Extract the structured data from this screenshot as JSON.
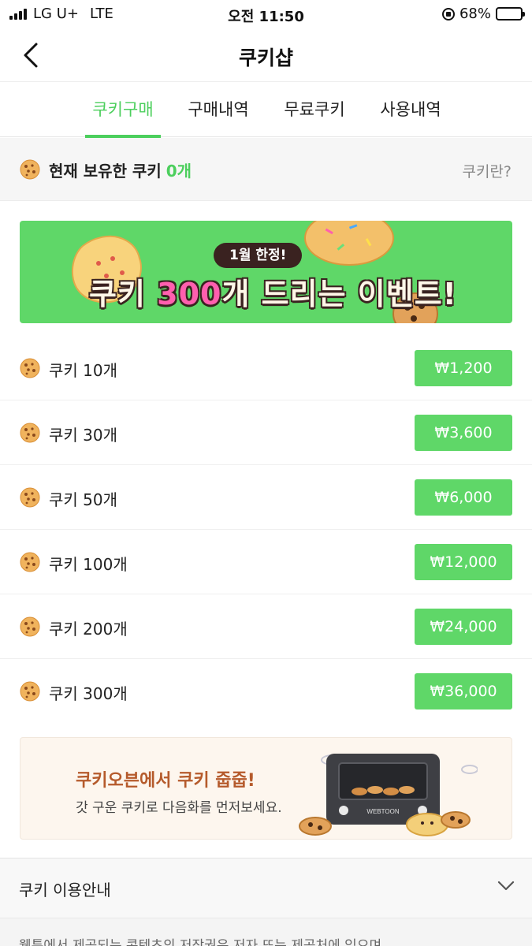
{
  "status_bar": {
    "carrier": "LG U+",
    "network": "LTE",
    "time": "오전 11:50",
    "battery": "68%",
    "battery_level": 0.68
  },
  "header": {
    "title": "쿠키샵"
  },
  "tabs": [
    {
      "label": "쿠키구매",
      "active": true
    },
    {
      "label": "구매내역",
      "active": false
    },
    {
      "label": "무료쿠키",
      "active": false
    },
    {
      "label": "사용내역",
      "active": false
    }
  ],
  "balance": {
    "label": "현재 보유한 쿠키",
    "count": "0개",
    "help_link": "쿠키란?"
  },
  "event_banner": {
    "badge": "1월 한정!",
    "title_prefix": "쿠키 ",
    "title_highlight": "300",
    "title_suffix": "개 드리는 이벤트!"
  },
  "products": [
    {
      "name": "쿠키 10개",
      "price": "₩1,200"
    },
    {
      "name": "쿠키 30개",
      "price": "₩3,600"
    },
    {
      "name": "쿠키 50개",
      "price": "₩6,000"
    },
    {
      "name": "쿠키 100개",
      "price": "₩12,000"
    },
    {
      "name": "쿠키 200개",
      "price": "₩24,000"
    },
    {
      "name": "쿠키 300개",
      "price": "₩36,000"
    }
  ],
  "oven_banner": {
    "title": "쿠키오븐에서 쿠키 줍줍!",
    "subtitle": "갓 구운 쿠키로 다음화를 먼저보세요.",
    "oven_brand": "WEBTOON"
  },
  "info": {
    "title": "쿠키 이용안내",
    "text": "웹툰에서 제공되는 콘텐츠의 저작권은 저자 또는 제공처에 있으며"
  },
  "colors": {
    "accent": "#4ccf5d",
    "button": "#5fd768",
    "cookie": "#e8a24a"
  }
}
